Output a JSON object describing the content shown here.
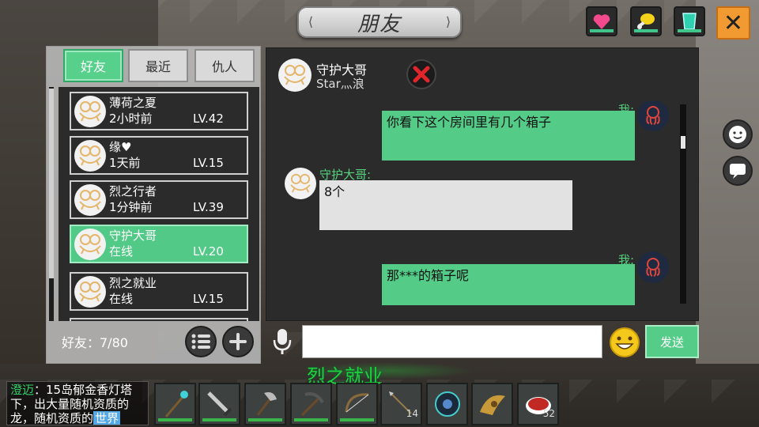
{
  "title": "朋友",
  "top_buttons": {
    "heart_icon": "heart-icon",
    "food_icon": "drumstick-icon",
    "drink_icon": "cup-icon",
    "close_label": "✕"
  },
  "tabs": [
    {
      "label": "好友",
      "active": true
    },
    {
      "label": "最近",
      "active": false
    },
    {
      "label": "仇人",
      "active": false
    }
  ],
  "friends": [
    {
      "name": "薄荷之夏",
      "time": "2小时前",
      "level": "LV.42",
      "active": false
    },
    {
      "name": "缘♥",
      "time": "1天前",
      "level": "LV.15",
      "active": false
    },
    {
      "name": "烈之行者",
      "time": "1分钟前",
      "level": "LV.39",
      "active": false
    },
    {
      "name": "守护大哥",
      "time": "在线",
      "level": "LV.20",
      "active": true
    },
    {
      "name": "烈之就业",
      "time": "在线",
      "level": "LV.15",
      "active": false
    }
  ],
  "friend_count": "好友：7/80",
  "chat": {
    "name": "守护大哥",
    "subtitle": "Star灬浪",
    "messages": [
      {
        "sender": "我:",
        "text": "你看下这个房间里有几个箱子",
        "from_me": true
      },
      {
        "sender": "守护大哥:",
        "text": "8个",
        "from_me": false
      },
      {
        "sender": "我:",
        "text": "那***的箱子呢",
        "from_me": true
      }
    ]
  },
  "input": {
    "value": "",
    "placeholder": ""
  },
  "send_label": "发送",
  "world_name": "烈之就业",
  "news": {
    "who": "澄迈",
    "text": "：15岛郁金香灯塔下，出大量随机资质的龙，随机资质的",
    "tag": "世界"
  },
  "hotbar": [
    {
      "icon": "staff-icon",
      "qty": ""
    },
    {
      "icon": "sword-icon",
      "qty": ""
    },
    {
      "icon": "axe-icon",
      "qty": ""
    },
    {
      "icon": "pickaxe-icon",
      "qty": ""
    },
    {
      "icon": "bow-icon",
      "qty": ""
    },
    {
      "icon": "arrow-icon",
      "qty": "14"
    },
    {
      "icon": "orb-icon",
      "qty": ""
    },
    {
      "icon": "horn-icon",
      "qty": ""
    },
    {
      "icon": "meat-bowl-icon",
      "qty": "52"
    }
  ],
  "colors": {
    "accent": "#55cc88",
    "close": "#f29a32",
    "speaker": "#55d27e"
  }
}
